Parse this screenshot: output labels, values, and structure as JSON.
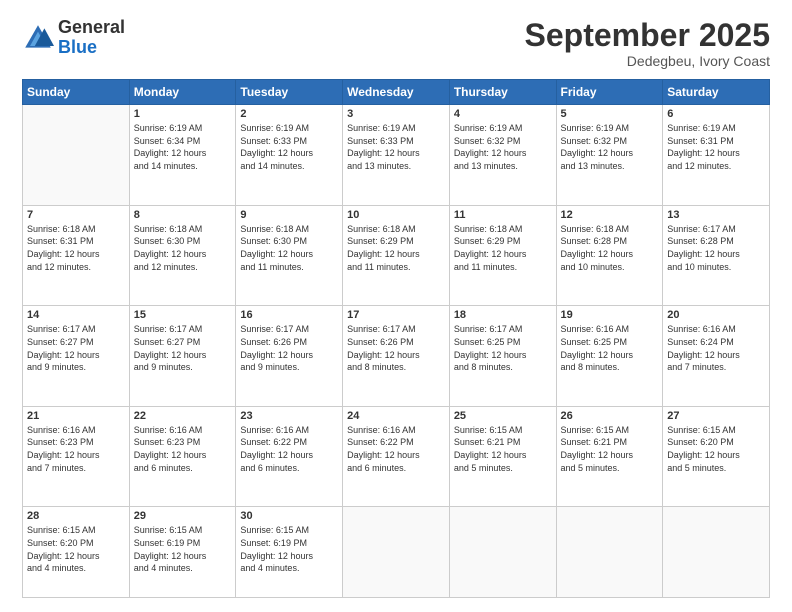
{
  "logo": {
    "general": "General",
    "blue": "Blue"
  },
  "header": {
    "month": "September 2025",
    "location": "Dedegbeu, Ivory Coast"
  },
  "weekdays": [
    "Sunday",
    "Monday",
    "Tuesday",
    "Wednesday",
    "Thursday",
    "Friday",
    "Saturday"
  ],
  "weeks": [
    [
      {
        "day": "",
        "info": ""
      },
      {
        "day": "1",
        "info": "Sunrise: 6:19 AM\nSunset: 6:34 PM\nDaylight: 12 hours\nand 14 minutes."
      },
      {
        "day": "2",
        "info": "Sunrise: 6:19 AM\nSunset: 6:33 PM\nDaylight: 12 hours\nand 14 minutes."
      },
      {
        "day": "3",
        "info": "Sunrise: 6:19 AM\nSunset: 6:33 PM\nDaylight: 12 hours\nand 13 minutes."
      },
      {
        "day": "4",
        "info": "Sunrise: 6:19 AM\nSunset: 6:32 PM\nDaylight: 12 hours\nand 13 minutes."
      },
      {
        "day": "5",
        "info": "Sunrise: 6:19 AM\nSunset: 6:32 PM\nDaylight: 12 hours\nand 13 minutes."
      },
      {
        "day": "6",
        "info": "Sunrise: 6:19 AM\nSunset: 6:31 PM\nDaylight: 12 hours\nand 12 minutes."
      }
    ],
    [
      {
        "day": "7",
        "info": "Sunrise: 6:18 AM\nSunset: 6:31 PM\nDaylight: 12 hours\nand 12 minutes."
      },
      {
        "day": "8",
        "info": "Sunrise: 6:18 AM\nSunset: 6:30 PM\nDaylight: 12 hours\nand 12 minutes."
      },
      {
        "day": "9",
        "info": "Sunrise: 6:18 AM\nSunset: 6:30 PM\nDaylight: 12 hours\nand 11 minutes."
      },
      {
        "day": "10",
        "info": "Sunrise: 6:18 AM\nSunset: 6:29 PM\nDaylight: 12 hours\nand 11 minutes."
      },
      {
        "day": "11",
        "info": "Sunrise: 6:18 AM\nSunset: 6:29 PM\nDaylight: 12 hours\nand 11 minutes."
      },
      {
        "day": "12",
        "info": "Sunrise: 6:18 AM\nSunset: 6:28 PM\nDaylight: 12 hours\nand 10 minutes."
      },
      {
        "day": "13",
        "info": "Sunrise: 6:17 AM\nSunset: 6:28 PM\nDaylight: 12 hours\nand 10 minutes."
      }
    ],
    [
      {
        "day": "14",
        "info": "Sunrise: 6:17 AM\nSunset: 6:27 PM\nDaylight: 12 hours\nand 9 minutes."
      },
      {
        "day": "15",
        "info": "Sunrise: 6:17 AM\nSunset: 6:27 PM\nDaylight: 12 hours\nand 9 minutes."
      },
      {
        "day": "16",
        "info": "Sunrise: 6:17 AM\nSunset: 6:26 PM\nDaylight: 12 hours\nand 9 minutes."
      },
      {
        "day": "17",
        "info": "Sunrise: 6:17 AM\nSunset: 6:26 PM\nDaylight: 12 hours\nand 8 minutes."
      },
      {
        "day": "18",
        "info": "Sunrise: 6:17 AM\nSunset: 6:25 PM\nDaylight: 12 hours\nand 8 minutes."
      },
      {
        "day": "19",
        "info": "Sunrise: 6:16 AM\nSunset: 6:25 PM\nDaylight: 12 hours\nand 8 minutes."
      },
      {
        "day": "20",
        "info": "Sunrise: 6:16 AM\nSunset: 6:24 PM\nDaylight: 12 hours\nand 7 minutes."
      }
    ],
    [
      {
        "day": "21",
        "info": "Sunrise: 6:16 AM\nSunset: 6:23 PM\nDaylight: 12 hours\nand 7 minutes."
      },
      {
        "day": "22",
        "info": "Sunrise: 6:16 AM\nSunset: 6:23 PM\nDaylight: 12 hours\nand 6 minutes."
      },
      {
        "day": "23",
        "info": "Sunrise: 6:16 AM\nSunset: 6:22 PM\nDaylight: 12 hours\nand 6 minutes."
      },
      {
        "day": "24",
        "info": "Sunrise: 6:16 AM\nSunset: 6:22 PM\nDaylight: 12 hours\nand 6 minutes."
      },
      {
        "day": "25",
        "info": "Sunrise: 6:15 AM\nSunset: 6:21 PM\nDaylight: 12 hours\nand 5 minutes."
      },
      {
        "day": "26",
        "info": "Sunrise: 6:15 AM\nSunset: 6:21 PM\nDaylight: 12 hours\nand 5 minutes."
      },
      {
        "day": "27",
        "info": "Sunrise: 6:15 AM\nSunset: 6:20 PM\nDaylight: 12 hours\nand 5 minutes."
      }
    ],
    [
      {
        "day": "28",
        "info": "Sunrise: 6:15 AM\nSunset: 6:20 PM\nDaylight: 12 hours\nand 4 minutes."
      },
      {
        "day": "29",
        "info": "Sunrise: 6:15 AM\nSunset: 6:19 PM\nDaylight: 12 hours\nand 4 minutes."
      },
      {
        "day": "30",
        "info": "Sunrise: 6:15 AM\nSunset: 6:19 PM\nDaylight: 12 hours\nand 4 minutes."
      },
      {
        "day": "",
        "info": ""
      },
      {
        "day": "",
        "info": ""
      },
      {
        "day": "",
        "info": ""
      },
      {
        "day": "",
        "info": ""
      }
    ]
  ]
}
